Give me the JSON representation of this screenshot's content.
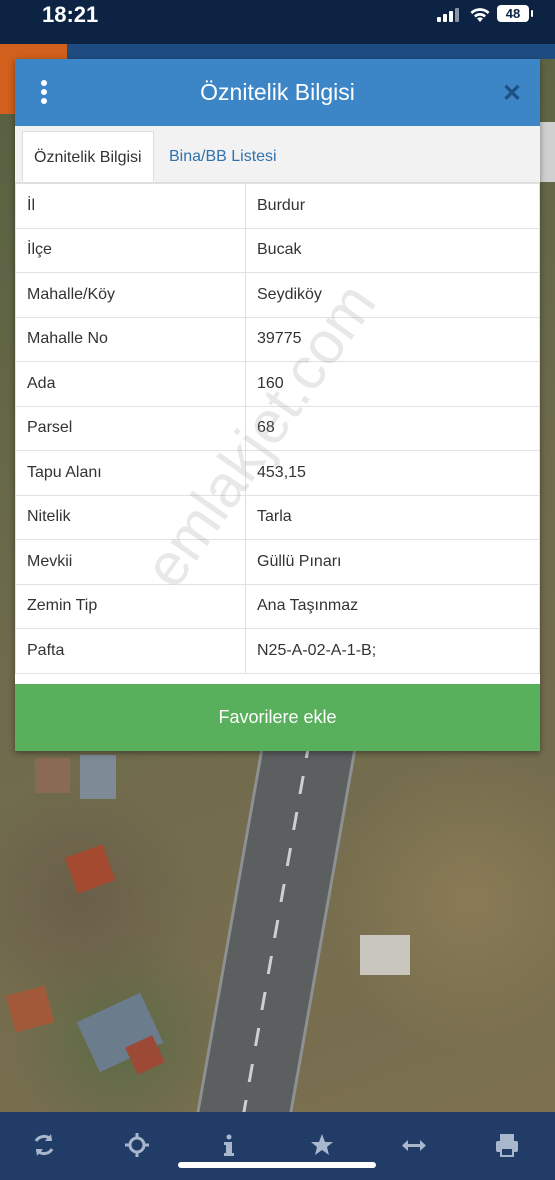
{
  "status_bar": {
    "time": "18:21",
    "battery": "48"
  },
  "dialog": {
    "title": "Öznitelik Bilgisi",
    "tabs": [
      {
        "label": "Öznitelik Bilgisi",
        "active": true
      },
      {
        "label": "Bina/BB Listesi",
        "active": false
      }
    ],
    "rows": [
      {
        "key": "İl",
        "value": "Burdur"
      },
      {
        "key": "İlçe",
        "value": "Bucak"
      },
      {
        "key": "Mahalle/Köy",
        "value": "Seydiköy"
      },
      {
        "key": "Mahalle No",
        "value": "39775"
      },
      {
        "key": "Ada",
        "value": "160"
      },
      {
        "key": "Parsel",
        "value": "68"
      },
      {
        "key": "Tapu Alanı",
        "value": "453,15"
      },
      {
        "key": "Nitelik",
        "value": "Tarla"
      },
      {
        "key": "Mevkii",
        "value": "Güllü Pınarı"
      },
      {
        "key": "Zemin Tip",
        "value": "Ana Taşınmaz"
      },
      {
        "key": "Pafta",
        "value": "N25-A-02-A-1-B;"
      }
    ],
    "favorite_button": "Favorilere ekle",
    "watermark": "emlakjet.com"
  },
  "toolbar": {
    "icons": [
      "refresh-icon",
      "locate-icon",
      "info-icon",
      "star-icon",
      "measure-icon",
      "print-icon"
    ]
  },
  "colors": {
    "header": "#3c85c6",
    "favorite_button": "#59b05c",
    "toolbar": "#213c66",
    "status_bar": "#0d2344"
  }
}
